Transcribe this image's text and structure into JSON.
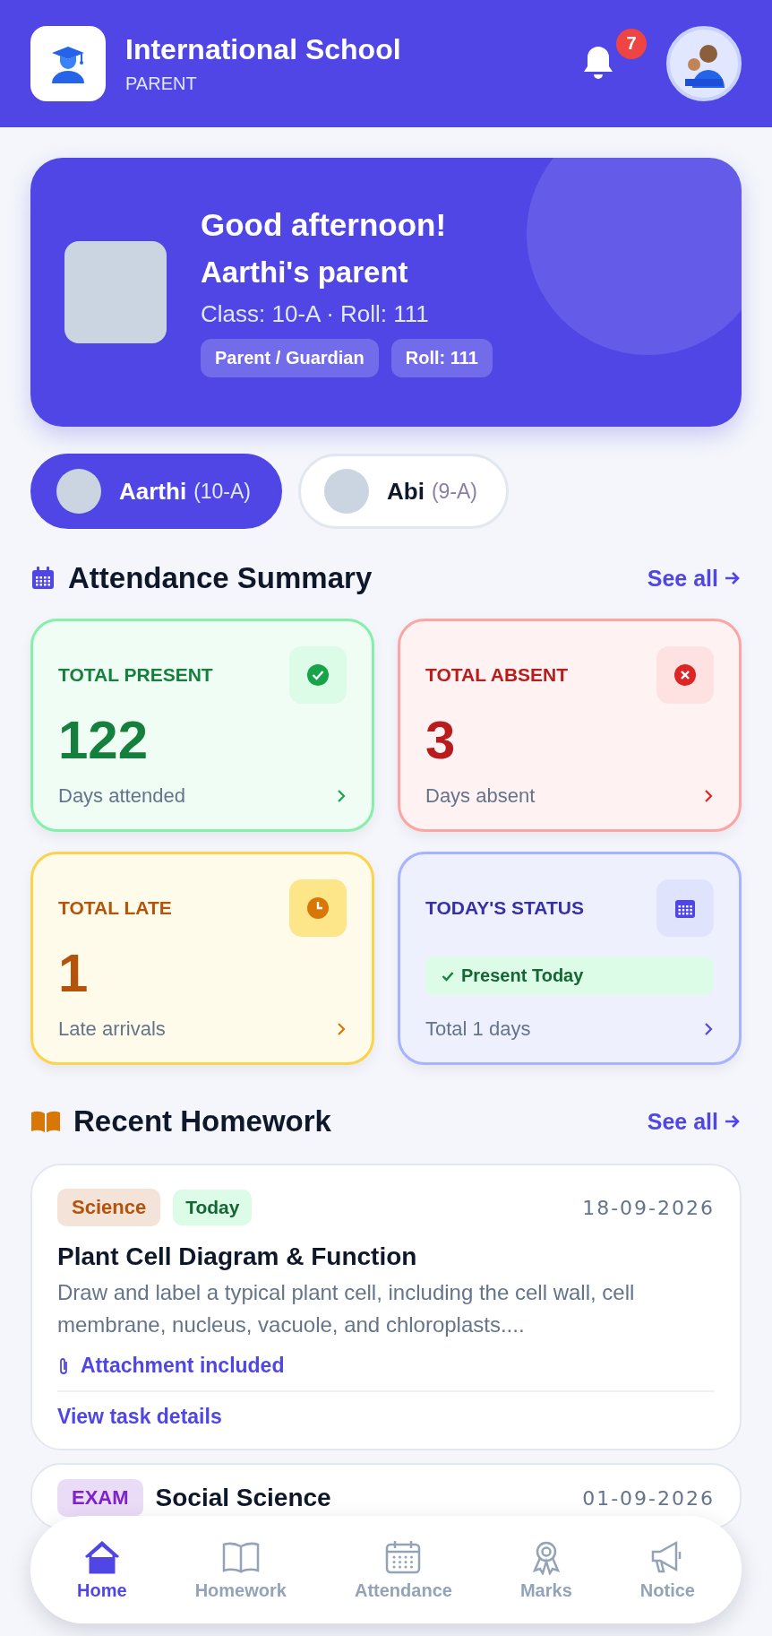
{
  "header": {
    "school_name": "International School",
    "role": "PARENT",
    "notification_count": "7"
  },
  "greeting": {
    "title": "Good afternoon!",
    "name": "Aarthi's parent",
    "details": "Class: 10-A · Roll: 111",
    "tags": [
      "Parent / Guardian",
      "Roll: 111"
    ]
  },
  "children": [
    {
      "name": "Aarthi",
      "class": "(10-A)",
      "selected": true
    },
    {
      "name": "Abi",
      "class": "(9-A)",
      "selected": false
    }
  ],
  "attendance": {
    "title": "Attendance Summary",
    "see_all": "See all",
    "cards": [
      {
        "kind": "present",
        "label": "TOTAL PRESENT",
        "value": "122",
        "caption": "Days attended"
      },
      {
        "kind": "absent",
        "label": "TOTAL ABSENT",
        "value": "3",
        "caption": "Days absent"
      },
      {
        "kind": "late",
        "label": "TOTAL LATE",
        "value": "1",
        "caption": "Late arrivals"
      },
      {
        "kind": "status",
        "label": "TODAY'S STATUS",
        "status": "Present Today",
        "caption": "Total 1 days"
      }
    ]
  },
  "homework": {
    "title": "Recent Homework",
    "see_all": "See all",
    "items": [
      {
        "subject": "Science",
        "color": "#b45309",
        "due": "Today",
        "date": "18-09-2026",
        "title": "Plant Cell Diagram & Function",
        "description": "Draw and label a typical plant cell, including the cell wall, cell membrane, nucleus, vacuole, and chloroplasts....",
        "attachment": "Attachment included",
        "link": "View task details"
      },
      {
        "subject": "EXAM",
        "color": "#7e22ce",
        "date": "01-09-2026",
        "title": "Social Science"
      }
    ]
  },
  "nav": [
    {
      "label": "Home",
      "selected": true
    },
    {
      "label": "Homework",
      "selected": false
    },
    {
      "label": "Attendance",
      "selected": false
    },
    {
      "label": "Marks",
      "selected": false
    },
    {
      "label": "Notice",
      "selected": false
    }
  ]
}
